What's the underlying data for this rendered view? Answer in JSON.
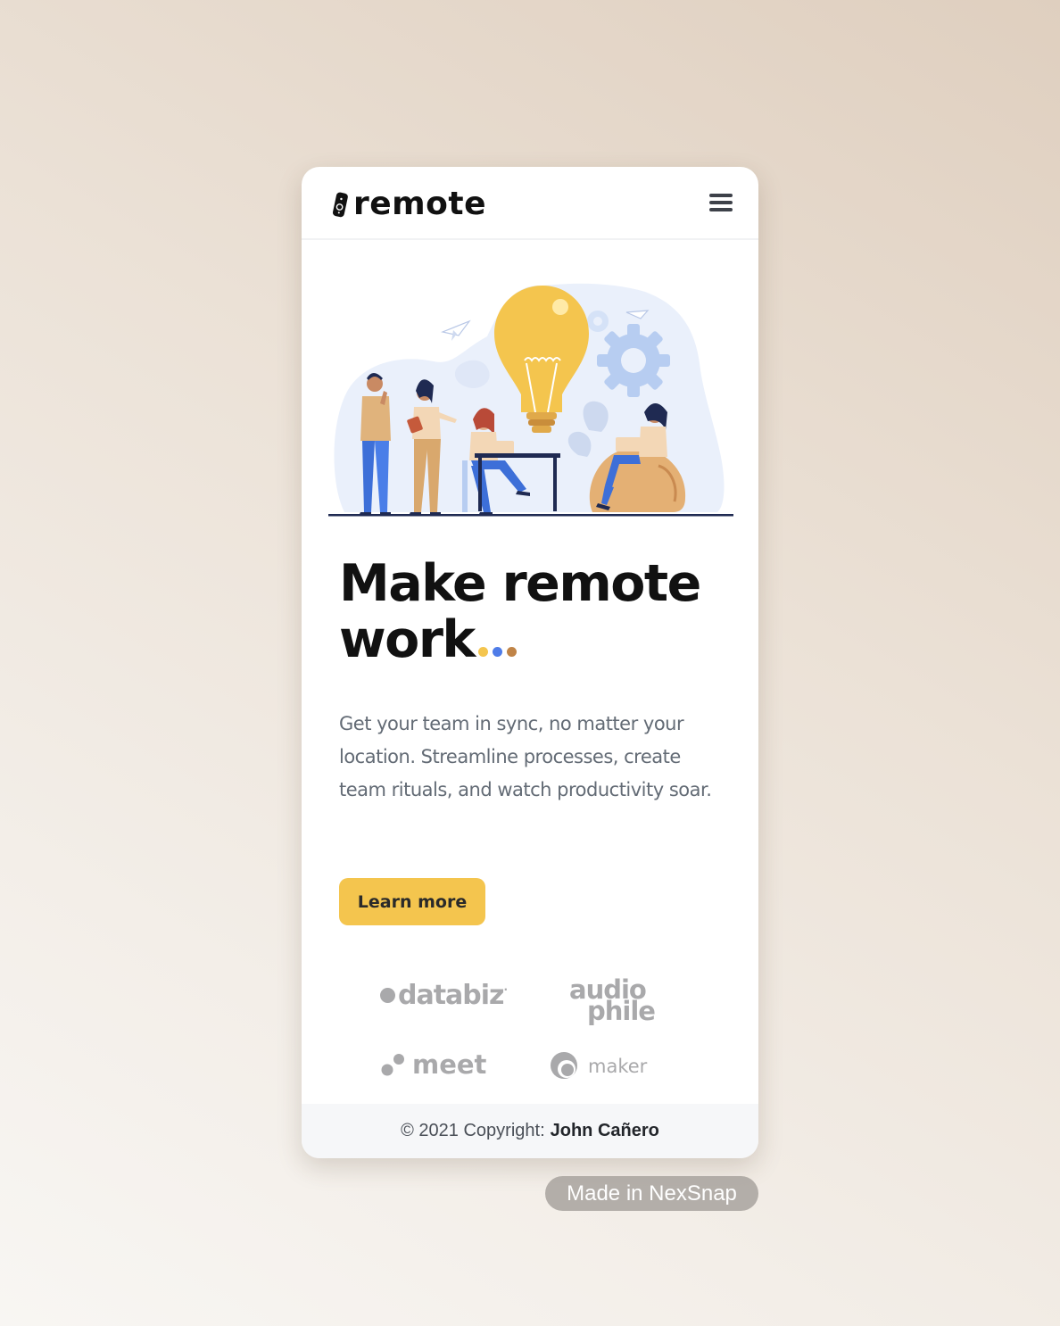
{
  "header": {
    "logo_text": "remote",
    "menu_icon": "hamburger-menu-icon"
  },
  "hero": {
    "illustration": "team-lightbulb-illustration",
    "headline_line1": "Make remote",
    "headline_line2": "work",
    "headline_dot_colors": [
      "#f4c54e",
      "#4f7ce8",
      "#c08447"
    ],
    "description": "Get your team in sync, no matter your location. Streamline processes, create team rituals, and watch productivity soar.",
    "cta_label": "Learn more"
  },
  "clients": [
    {
      "name": "databiz"
    },
    {
      "name_line1": "audio",
      "name_line2": "phile"
    },
    {
      "name": "meet"
    },
    {
      "name": "maker"
    }
  ],
  "footer": {
    "copyright_prefix": "© 2021 Copyright:",
    "author": "John Cañero"
  },
  "watermark": "Made in NexSnap",
  "colors": {
    "accent_yellow": "#f4c54e",
    "accent_blue": "#4f7ce8",
    "accent_brown": "#c08447",
    "text_dark": "#111111",
    "text_muted": "#636b75",
    "logo_grey": "#a9a9ab"
  }
}
